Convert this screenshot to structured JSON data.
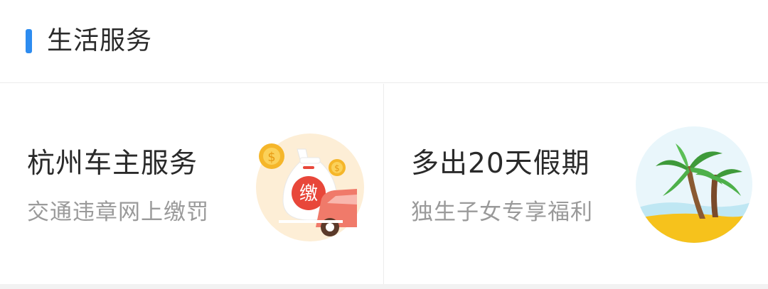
{
  "section": {
    "title": "生活服务",
    "accent_color": "#2d8cf0"
  },
  "cards": [
    {
      "title": "杭州车主服务",
      "subtitle": "交通违章网上缴罚",
      "icon": "traffic-fine-payment-icon",
      "icon_text": "缴"
    },
    {
      "title": "多出20天假期",
      "subtitle": "独生子女专享福利",
      "icon": "palm-tree-beach-icon"
    }
  ]
}
